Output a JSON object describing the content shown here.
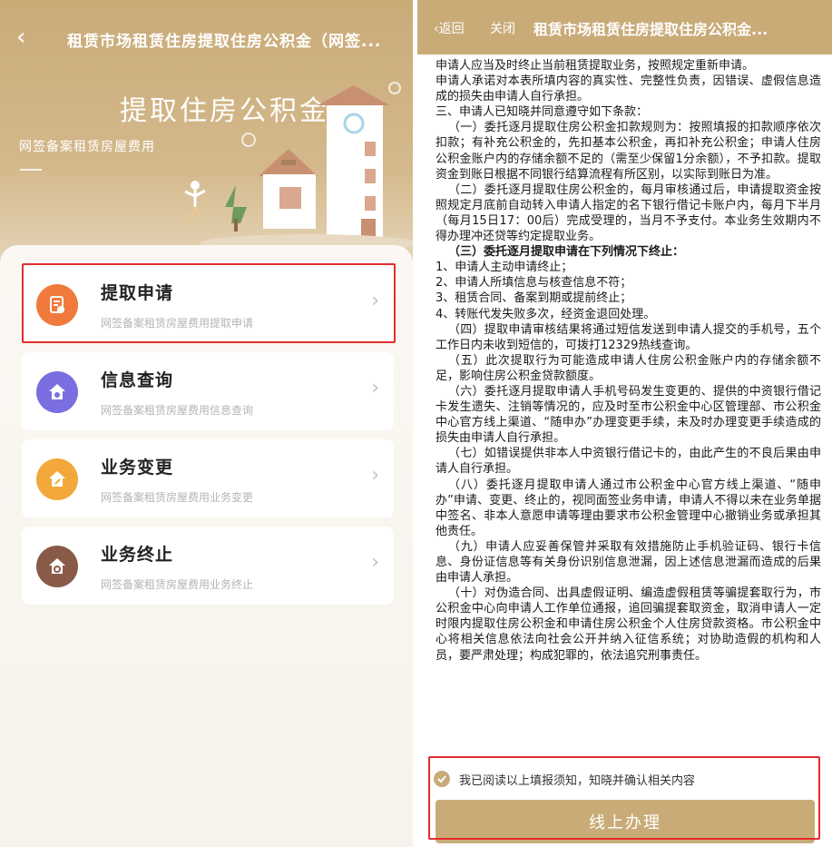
{
  "left": {
    "nav": {
      "title": "租赁市场租赁住房提取住房公积金（网签..."
    },
    "hero": {
      "title": "提取住房公积金",
      "subtitle": "网签备案租赁房屋费用"
    },
    "menu": [
      {
        "label": "提取申请",
        "desc": "网签备案租赁房屋费用提取申请",
        "icon": "document-icon",
        "color": "#f07a3c",
        "highlighted": true
      },
      {
        "label": "信息查询",
        "desc": "网签备案租赁房屋费用信息查询",
        "icon": "house-search-icon",
        "color": "#7a6ee0",
        "highlighted": false
      },
      {
        "label": "业务变更",
        "desc": "网签备案租赁房屋费用业务变更",
        "icon": "house-edit-icon",
        "color": "#f2a83a",
        "highlighted": false
      },
      {
        "label": "业务终止",
        "desc": "网签备案租赁房屋费用业务终止",
        "icon": "house-stop-icon",
        "color": "#8a5a48",
        "highlighted": false
      }
    ]
  },
  "right": {
    "nav": {
      "back": "返回",
      "close": "关闭",
      "title": "租赁市场租赁住房提取住房公积金..."
    },
    "doc": [
      {
        "text": "申请人应当及时终止当前租赁提取业务，按照规定重新申请。",
        "bold": false,
        "indent": false
      },
      {
        "text": "申请人承诺对本表所填内容的真实性、完整性负责，因错误、虚假信息造成的损失由申请人自行承担。",
        "bold": false,
        "indent": false
      },
      {
        "text": "三、申请人已知晓并同意遵守如下条款：",
        "bold": false,
        "indent": false
      },
      {
        "text": "（一）委托逐月提取住房公积金扣款规则为：按照填报的扣款顺序依次扣款；有补充公积金的，先扣基本公积金，再扣补充公积金；申请人住房公积金账户内的存储余额不足的（需至少保留1分余额），不予扣款。提取资金到账日根据不同银行结算流程有所区别，以实际到账日为准。",
        "bold": false,
        "indent": true
      },
      {
        "text": "（二）委托逐月提取住房公积金的，每月审核通过后，申请提取资金按照规定月底前自动转入申请人指定的名下银行借记卡账户内，每月下半月（每月15日17：00后）完成受理的，当月不予支付。本业务生效期内不得办理冲还贷等约定提取业务。",
        "bold": false,
        "indent": true
      },
      {
        "text": "（三）委托逐月提取申请在下列情况下终止：",
        "bold": true,
        "indent": true
      },
      {
        "text": "1、申请人主动申请终止；",
        "bold": false,
        "indent": false
      },
      {
        "text": "2、申请人所填信息与核查信息不符；",
        "bold": false,
        "indent": false
      },
      {
        "text": "3、租赁合同、备案到期或提前终止；",
        "bold": false,
        "indent": false
      },
      {
        "text": "4、转账代发失败多次，经资金退回处理。",
        "bold": false,
        "indent": false
      },
      {
        "text": "（四）提取申请审核结果将通过短信发送到申请人提交的手机号，五个工作日内未收到短信的，可拨打12329热线查询。",
        "bold": false,
        "indent": true
      },
      {
        "text": "（五）此次提取行为可能造成申请人住房公积金账户内的存储余额不足，影响住房公积金贷款额度。",
        "bold": false,
        "indent": true
      },
      {
        "text": "（六）委托逐月提取申请人手机号码发生变更的、提供的中资银行借记卡发生遗失、注销等情况的，应及时至市公积金中心区管理部、市公积金中心官方线上渠道、“随申办”办理变更手续，未及时办理变更手续造成的损失由申请人自行承担。",
        "bold": false,
        "indent": true
      },
      {
        "text": "（七）如错误提供非本人中资银行借记卡的，由此产生的不良后果由申请人自行承担。",
        "bold": false,
        "indent": true
      },
      {
        "text": "（八）委托逐月提取申请人通过市公积金中心官方线上渠道、“随申办”申请、变更、终止的，视同面签业务申请，申请人不得以未在业务单据中签名、非本人意愿申请等理由要求市公积金管理中心撤销业务或承担其他责任。",
        "bold": false,
        "indent": true
      },
      {
        "text": "（九）申请人应妥善保管并采取有效措施防止手机验证码、银行卡信息、身份证信息等有关身份识别信息泄漏，因上述信息泄漏而造成的后果由申请人承担。",
        "bold": false,
        "indent": true
      },
      {
        "text": "（十）对伪造合同、出具虚假证明、编造虚假租赁等骗提套取行为，市公积金中心向申请人工作单位通报，追回骗提套取资金，取消申请人一定时限内提取住房公积金和申请住房公积金个人住房贷款资格。市公积金中心将相关信息依法向社会公开并纳入征信系统；对协助造假的机构和人员，要严肃处理；构成犯罪的，依法追究刑事责任。",
        "bold": false,
        "indent": true
      }
    ],
    "agree_text": "我已阅读以上填报须知，知晓并确认相关内容",
    "agree_checked": true,
    "submit_label": "线上办理"
  },
  "colors": {
    "brand": "#c9ab78",
    "highlight": "#e52d2d"
  }
}
